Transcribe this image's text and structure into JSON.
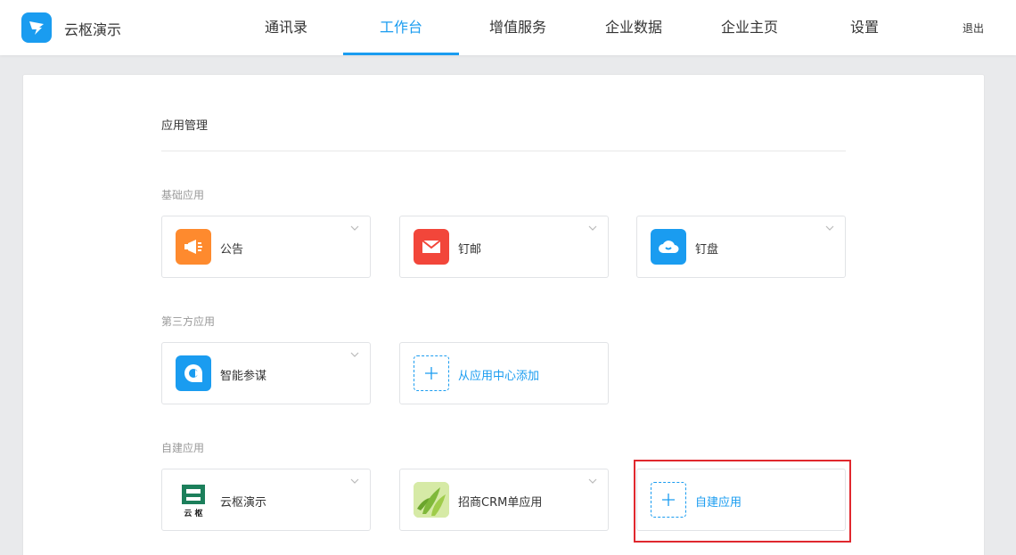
{
  "header": {
    "brand": "云枢演示",
    "nav": [
      {
        "label": "通讯录"
      },
      {
        "label": "工作台"
      },
      {
        "label": "增值服务"
      },
      {
        "label": "企业数据"
      },
      {
        "label": "企业主页"
      },
      {
        "label": "设置"
      }
    ],
    "logout": "退出"
  },
  "main": {
    "title": "应用管理",
    "groups": [
      {
        "label": "基础应用",
        "apps": [
          {
            "name": "公告",
            "icon": "megaphone-icon",
            "color": "#fe8a2e"
          },
          {
            "name": "钉邮",
            "icon": "mail-icon",
            "color": "#f2463a"
          },
          {
            "name": "钉盘",
            "icon": "cloud-icon",
            "color": "#1a9cf0"
          }
        ]
      },
      {
        "label": "第三方应用",
        "apps": [
          {
            "name": "智能参谋",
            "icon": "chat-bubble-icon",
            "color": "#1a9cf0"
          },
          {
            "name": "从应用中心添加",
            "icon": "plus-icon"
          }
        ]
      },
      {
        "label": "自建应用",
        "apps": [
          {
            "name": "云枢演示",
            "icon": "yunshu-logo-icon",
            "logo_text": "云 枢",
            "color": "#1c7f5b"
          },
          {
            "name": "招商CRM单应用",
            "icon": "leaf-image-icon",
            "color": "#9fcc4a"
          },
          {
            "name": "自建应用",
            "icon": "plus-icon"
          }
        ]
      }
    ]
  },
  "accent_color": "#1a9cf0",
  "highlight_color": "#e0282e"
}
